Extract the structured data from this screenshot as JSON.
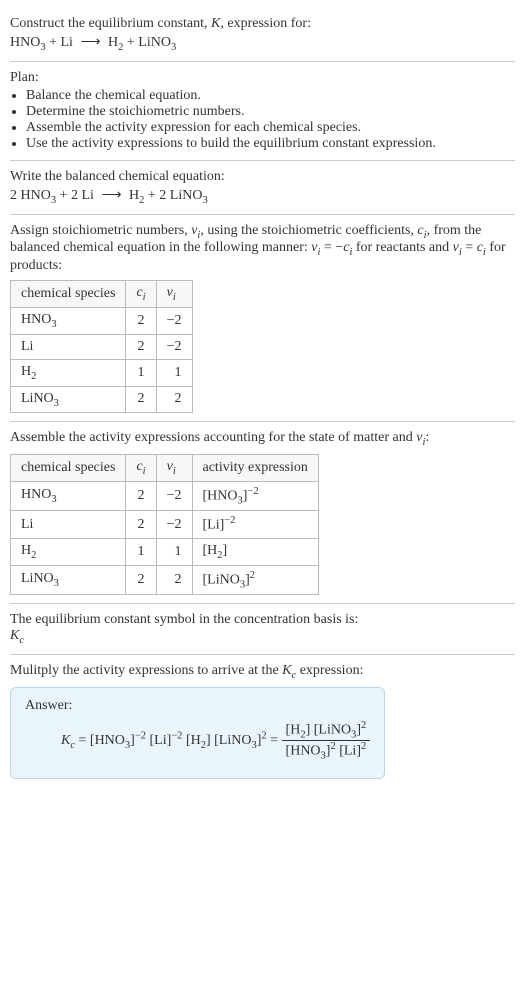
{
  "intro": {
    "line1": "Construct the equilibrium constant, K, expression for:",
    "equation": "HNO₃ + Li ⟶ H₂ + LiNO₃"
  },
  "plan": {
    "heading": "Plan:",
    "items": [
      "Balance the chemical equation.",
      "Determine the stoichiometric numbers.",
      "Assemble the activity expression for each chemical species.",
      "Use the activity expressions to build the equilibrium constant expression."
    ]
  },
  "balanced": {
    "heading": "Write the balanced chemical equation:",
    "equation": "2 HNO₃ + 2 Li ⟶ H₂ + 2 LiNO₃"
  },
  "assign": {
    "text": "Assign stoichiometric numbers, νᵢ, using the stoichiometric coefficients, cᵢ, from the balanced chemical equation in the following manner: νᵢ = −cᵢ for reactants and νᵢ = cᵢ for products:",
    "headers": [
      "chemical species",
      "cᵢ",
      "νᵢ"
    ],
    "rows": [
      {
        "species": "HNO₃",
        "c": "2",
        "v": "−2"
      },
      {
        "species": "Li",
        "c": "2",
        "v": "−2"
      },
      {
        "species": "H₂",
        "c": "1",
        "v": "1"
      },
      {
        "species": "LiNO₃",
        "c": "2",
        "v": "2"
      }
    ]
  },
  "assemble": {
    "text": "Assemble the activity expressions accounting for the state of matter and νᵢ:",
    "headers": [
      "chemical species",
      "cᵢ",
      "νᵢ",
      "activity expression"
    ],
    "rows": [
      {
        "species": "HNO₃",
        "c": "2",
        "v": "−2",
        "act": "[HNO₃]⁻²"
      },
      {
        "species": "Li",
        "c": "2",
        "v": "−2",
        "act": "[Li]⁻²"
      },
      {
        "species": "H₂",
        "c": "1",
        "v": "1",
        "act": "[H₂]"
      },
      {
        "species": "LiNO₃",
        "c": "2",
        "v": "2",
        "act": "[LiNO₃]²"
      }
    ]
  },
  "basis": {
    "line1": "The equilibrium constant symbol in the concentration basis is:",
    "symbol": "K𝚌"
  },
  "multiply": {
    "text": "Mulitply the activity expressions to arrive at the K𝚌 expression:"
  },
  "answer": {
    "label": "Answer:",
    "lhs": "K𝚌 = [HNO₃]⁻² [Li]⁻² [H₂] [LiNO₃]² =",
    "num": "[H₂] [LiNO₃]²",
    "den": "[HNO₃]² [Li]²"
  },
  "chart_data": {
    "type": "table",
    "tables": [
      {
        "title": "Stoichiometric numbers",
        "columns": [
          "chemical species",
          "c_i",
          "ν_i"
        ],
        "rows": [
          [
            "HNO3",
            2,
            -2
          ],
          [
            "Li",
            2,
            -2
          ],
          [
            "H2",
            1,
            1
          ],
          [
            "LiNO3",
            2,
            2
          ]
        ]
      },
      {
        "title": "Activity expressions",
        "columns": [
          "chemical species",
          "c_i",
          "ν_i",
          "activity expression"
        ],
        "rows": [
          [
            "HNO3",
            2,
            -2,
            "[HNO3]^-2"
          ],
          [
            "Li",
            2,
            -2,
            "[Li]^-2"
          ],
          [
            "H2",
            1,
            1,
            "[H2]"
          ],
          [
            "LiNO3",
            2,
            2,
            "[LiNO3]^2"
          ]
        ]
      }
    ]
  }
}
